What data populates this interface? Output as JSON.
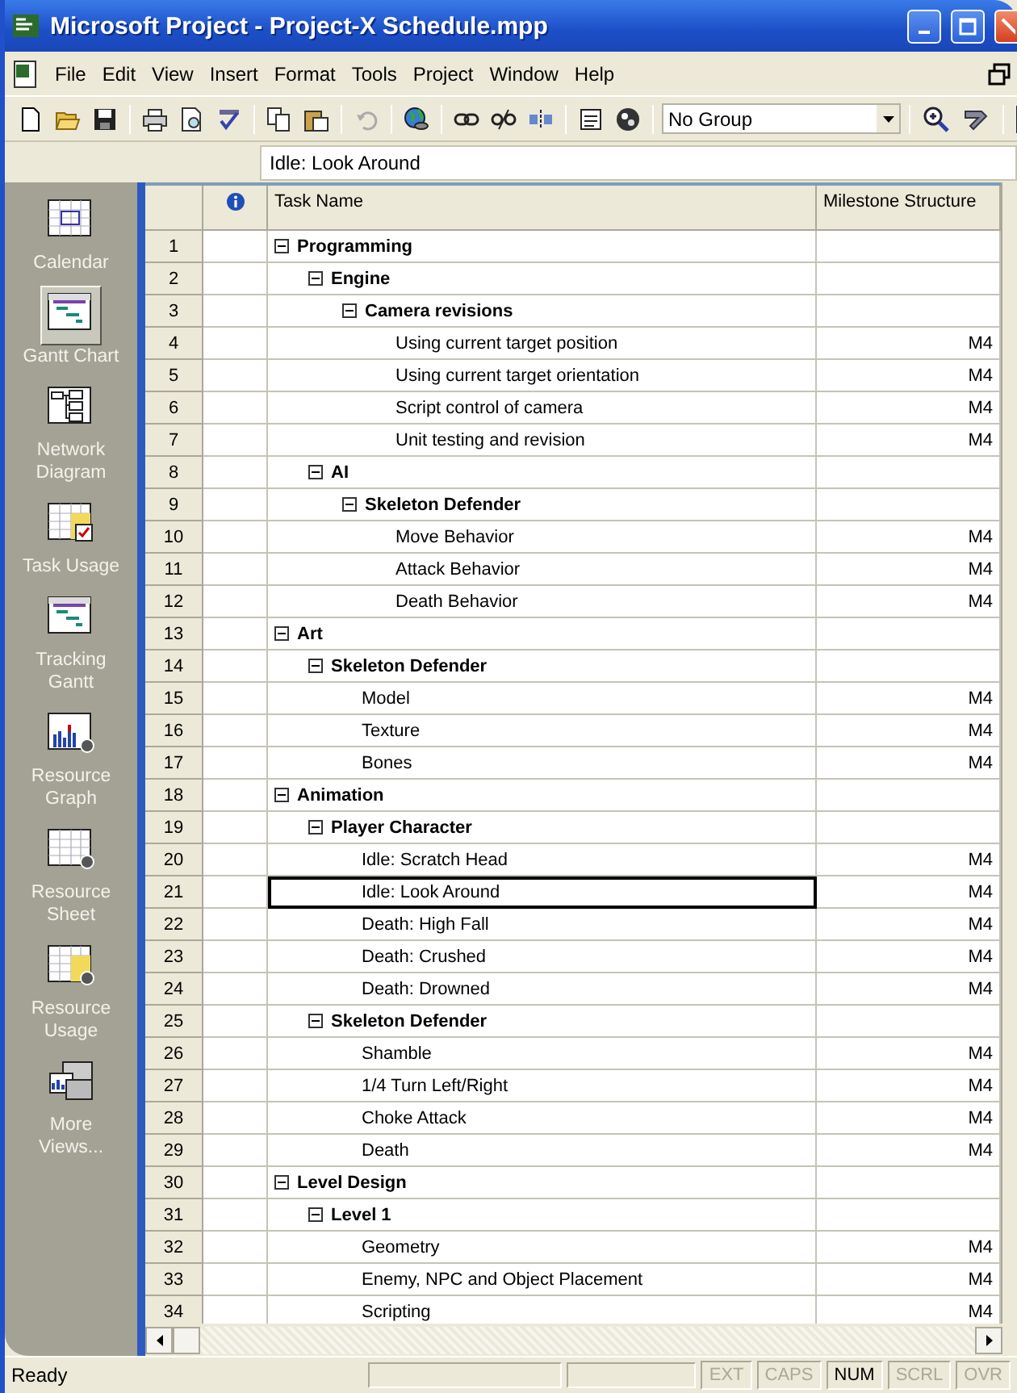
{
  "window": {
    "title": "Microsoft Project - Project-X Schedule.mpp"
  },
  "menu": [
    "File",
    "Edit",
    "View",
    "Insert",
    "Format",
    "Tools",
    "Project",
    "Window",
    "Help"
  ],
  "toolbar": {
    "group_dropdown": "No Group"
  },
  "entry_bar": {
    "value": "Idle: Look Around"
  },
  "view_bar": [
    {
      "label": "Calendar",
      "selected": false
    },
    {
      "label": "Gantt Chart",
      "selected": true
    },
    {
      "label": "Network Diagram",
      "selected": false
    },
    {
      "label": "Task Usage",
      "selected": false
    },
    {
      "label": "Tracking Gantt",
      "selected": false
    },
    {
      "label": "Resource Graph",
      "selected": false
    },
    {
      "label": "Resource Sheet",
      "selected": false
    },
    {
      "label": "Resource Usage",
      "selected": false
    },
    {
      "label": "More Views...",
      "selected": false
    }
  ],
  "table": {
    "columns": [
      "Task Name",
      "Milestone Structure"
    ],
    "tasks": [
      {
        "id": "1",
        "name": "Programming",
        "expanded": true,
        "selected": false,
        "children": [
          {
            "id": "2",
            "name": "Engine",
            "expanded": true,
            "selected": false,
            "children": [
              {
                "id": "3",
                "name": "Camera revisions",
                "expanded": true,
                "selected": false,
                "children": [
                  {
                    "id": "4",
                    "name": "Using current target position",
                    "milestone": "M4",
                    "selected": false
                  },
                  {
                    "id": "5",
                    "name": "Using current target orientation",
                    "milestone": "M4",
                    "selected": false
                  },
                  {
                    "id": "6",
                    "name": "Script control of camera",
                    "milestone": "M4",
                    "selected": false
                  },
                  {
                    "id": "7",
                    "name": "Unit testing and revision",
                    "milestone": "M4",
                    "selected": false
                  }
                ]
              }
            ]
          },
          {
            "id": "8",
            "name": "AI",
            "expanded": true,
            "selected": false,
            "children": [
              {
                "id": "9",
                "name": "Skeleton Defender",
                "expanded": true,
                "selected": false,
                "children": [
                  {
                    "id": "10",
                    "name": "Move Behavior",
                    "milestone": "M4",
                    "selected": false
                  },
                  {
                    "id": "11",
                    "name": "Attack Behavior",
                    "milestone": "M4",
                    "selected": false
                  },
                  {
                    "id": "12",
                    "name": "Death Behavior",
                    "milestone": "M4",
                    "selected": false
                  }
                ]
              }
            ]
          }
        ]
      },
      {
        "id": "13",
        "name": "Art",
        "expanded": true,
        "selected": false,
        "children": [
          {
            "id": "14",
            "name": "Skeleton Defender",
            "expanded": true,
            "selected": false,
            "children": [
              {
                "id": "15",
                "name": "Model",
                "milestone": "M4",
                "selected": false
              },
              {
                "id": "16",
                "name": "Texture",
                "milestone": "M4",
                "selected": false
              },
              {
                "id": "17",
                "name": "Bones",
                "milestone": "M4",
                "selected": false
              }
            ]
          }
        ]
      },
      {
        "id": "18",
        "name": "Animation",
        "expanded": true,
        "selected": false,
        "children": [
          {
            "id": "19",
            "name": "Player Character",
            "expanded": true,
            "selected": false,
            "children": [
              {
                "id": "20",
                "name": "Idle: Scratch Head",
                "milestone": "M4",
                "selected": false
              },
              {
                "id": "21",
                "name": "Idle: Look Around",
                "milestone": "M4",
                "selected": true
              },
              {
                "id": "22",
                "name": "Death: High Fall",
                "milestone": "M4",
                "selected": false
              },
              {
                "id": "23",
                "name": "Death: Crushed",
                "milestone": "M4",
                "selected": false
              },
              {
                "id": "24",
                "name": "Death: Drowned",
                "milestone": "M4",
                "selected": false
              }
            ]
          },
          {
            "id": "25",
            "name": "Skeleton Defender",
            "expanded": true,
            "selected": false,
            "children": [
              {
                "id": "26",
                "name": "Shamble",
                "milestone": "M4",
                "selected": false
              },
              {
                "id": "27",
                "name": "1/4 Turn Left/Right",
                "milestone": "M4",
                "selected": false
              },
              {
                "id": "28",
                "name": "Choke Attack",
                "milestone": "M4",
                "selected": false
              },
              {
                "id": "29",
                "name": "Death",
                "milestone": "M4",
                "selected": false
              }
            ]
          }
        ]
      },
      {
        "id": "30",
        "name": "Level Design",
        "expanded": true,
        "selected": false,
        "children": [
          {
            "id": "31",
            "name": "Level 1",
            "expanded": true,
            "selected": false,
            "children": [
              {
                "id": "32",
                "name": "Geometry",
                "milestone": "M4",
                "selected": false
              },
              {
                "id": "33",
                "name": "Enemy, NPC and Object Placement",
                "milestone": "M4",
                "selected": false
              },
              {
                "id": "34",
                "name": "Scripting",
                "milestone": "M4",
                "selected": false
              }
            ]
          }
        ]
      }
    ]
  },
  "status_bar": {
    "text": "Ready",
    "indicators": [
      {
        "label": "EXT",
        "on": false
      },
      {
        "label": "CAPS",
        "on": false
      },
      {
        "label": "NUM",
        "on": true
      },
      {
        "label": "SCRL",
        "on": false
      },
      {
        "label": "OVR",
        "on": false
      }
    ]
  }
}
